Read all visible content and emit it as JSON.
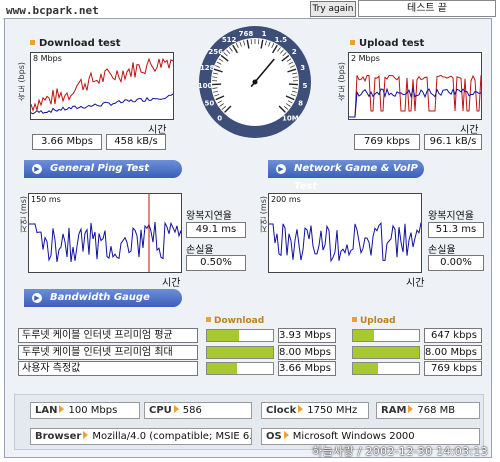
{
  "header": {
    "url": "www.bcpark.net",
    "try_again": "Try again",
    "test_end": "테스트 끝"
  },
  "download": {
    "title": "Download test",
    "unit_axis": "속도 (bps)",
    "scale": "8 Mbps",
    "time_label": "시간",
    "mbps": "3.66 Mbps",
    "kbs": "458 kB/s"
  },
  "upload": {
    "title": "Upload test",
    "unit_axis": "속도 (bps)",
    "scale": "2 Mbps",
    "time_label": "시간",
    "kbps": "769 kbps",
    "kbs": "96.1 kB/s"
  },
  "tabs": {
    "general_ping": "General Ping Test",
    "network_game": "Network Game & VoIP Test",
    "bandwidth": "Bandwidth Gauge"
  },
  "ping_general": {
    "axis": "지연 (ms)",
    "scale": "150 ms",
    "time_label": "시간",
    "rtt_label": "왕복지연율",
    "rtt": "49.1 ms",
    "loss_label": "손실율",
    "loss": "0.50%"
  },
  "ping_game": {
    "axis": "지연 (ms)",
    "scale": "200 ms",
    "time_label": "시간",
    "rtt_label": "왕복지연율",
    "rtt": "51.3 ms",
    "loss_label": "손실율",
    "loss": "0.00%"
  },
  "gauge": {
    "download_header": "Download",
    "upload_header": "Upload",
    "rows": [
      {
        "name": "두루넷 케이블 인터넷 프리미엄 평균",
        "down": "3.93 Mbps",
        "down_frac": 0.49,
        "up": "647 kbps",
        "up_frac": 0.32
      },
      {
        "name": "두루넷 케이블 인터넷 프리미엄 최대",
        "down": "8.00 Mbps",
        "down_frac": 1.0,
        "up": "8.00 Mbps",
        "up_frac": 1.0
      },
      {
        "name": "사용자 측정값",
        "down": "3.66 Mbps",
        "down_frac": 0.46,
        "up": "769 kbps",
        "up_frac": 0.38
      }
    ]
  },
  "sysinfo": {
    "lan_k": "LAN",
    "lan_v": "100 Mbps",
    "cpu_k": "CPU",
    "cpu_v": "586",
    "clock_k": "Clock",
    "clock_v": "1750 MHz",
    "ram_k": "RAM",
    "ram_v": "768 MB",
    "browser_k": "Browser",
    "browser_v": "Mozilla/4.0 (compatible; MSIE 6.0",
    "os_k": "OS",
    "os_v": "Microsoft Windows 2000"
  },
  "footer": "하늘사랑 / 2002-12-30 14:03:13",
  "dial_labels": [
    "0",
    "50",
    "100",
    "128",
    "256",
    "512",
    "768",
    "1",
    "1.5",
    "2",
    "3",
    "5",
    "8",
    "10M"
  ],
  "colors": {
    "accent": "#f0a030",
    "header_blue": "#3a5fb8",
    "bar_green": "#a8c830",
    "trace_red": "#c01010",
    "trace_blue": "#1010a0"
  }
}
